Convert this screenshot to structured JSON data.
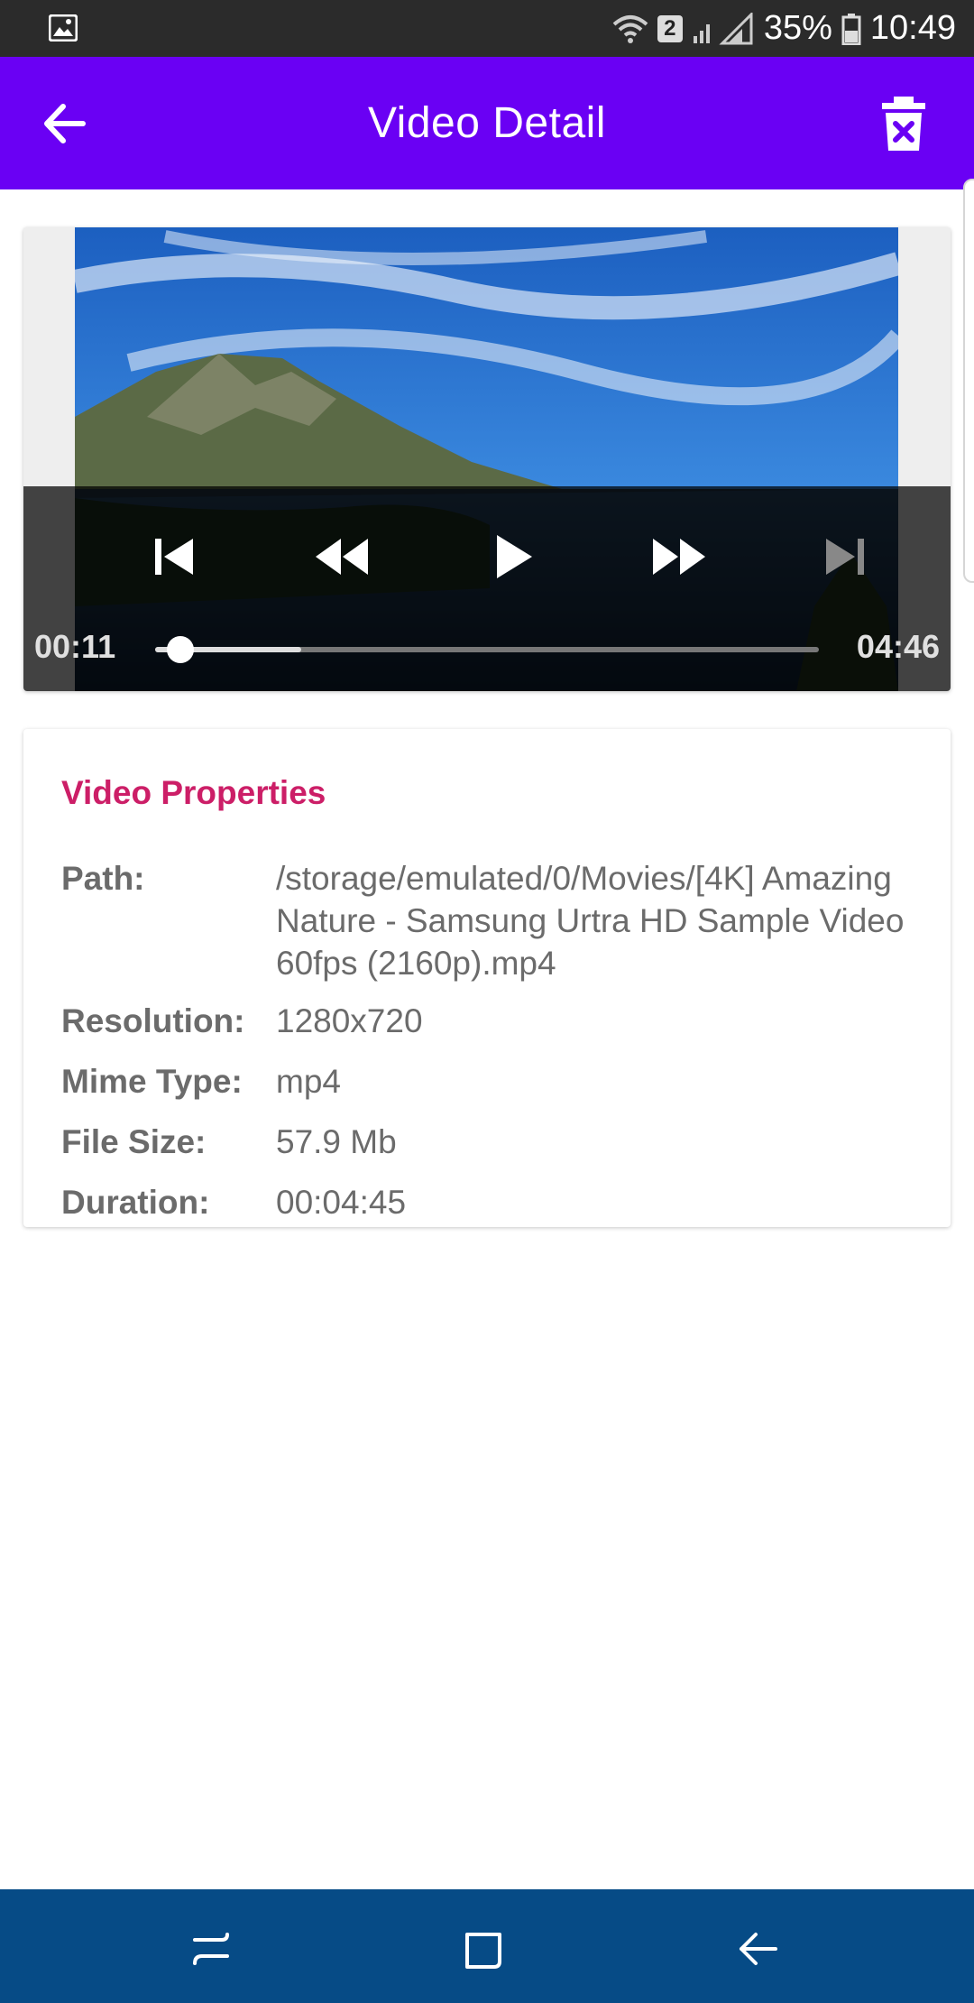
{
  "status_bar": {
    "battery_percent": "35%",
    "time": "10:49",
    "sim_badge": "2",
    "icons": [
      "gallery-icon",
      "wifi-icon",
      "signal-icon",
      "battery-icon"
    ]
  },
  "app_bar": {
    "title": "Video Detail",
    "back_icon": "arrow-left-icon",
    "delete_icon": "trash-x-icon",
    "color": "#6a00f4"
  },
  "player": {
    "current_time": "00:11",
    "duration": "04:46",
    "progress_fraction": 0.038,
    "buffered_fraction": 0.22,
    "controls": [
      "skip-previous-icon",
      "rewind-icon",
      "play-icon",
      "fast-forward-icon",
      "skip-next-icon"
    ]
  },
  "properties": {
    "title": "Video Properties",
    "title_color": "#cc1e67",
    "rows": [
      {
        "label": "Path:",
        "value": "/storage/emulated/0/Movies/[4K] Amazing Nature - Samsung Urtra HD Sample Video 60fps (2160p).mp4"
      },
      {
        "label": "Resolution:",
        "value": "1280x720"
      },
      {
        "label": "Mime Type:",
        "value": "mp4"
      },
      {
        "label": "File Size:",
        "value": "57.9 Mb"
      },
      {
        "label": "Duration:",
        "value": "00:04:45"
      }
    ]
  },
  "nav_bar": {
    "buttons": [
      "recent-apps-icon",
      "home-icon",
      "back-icon"
    ],
    "color": "#064b86"
  }
}
